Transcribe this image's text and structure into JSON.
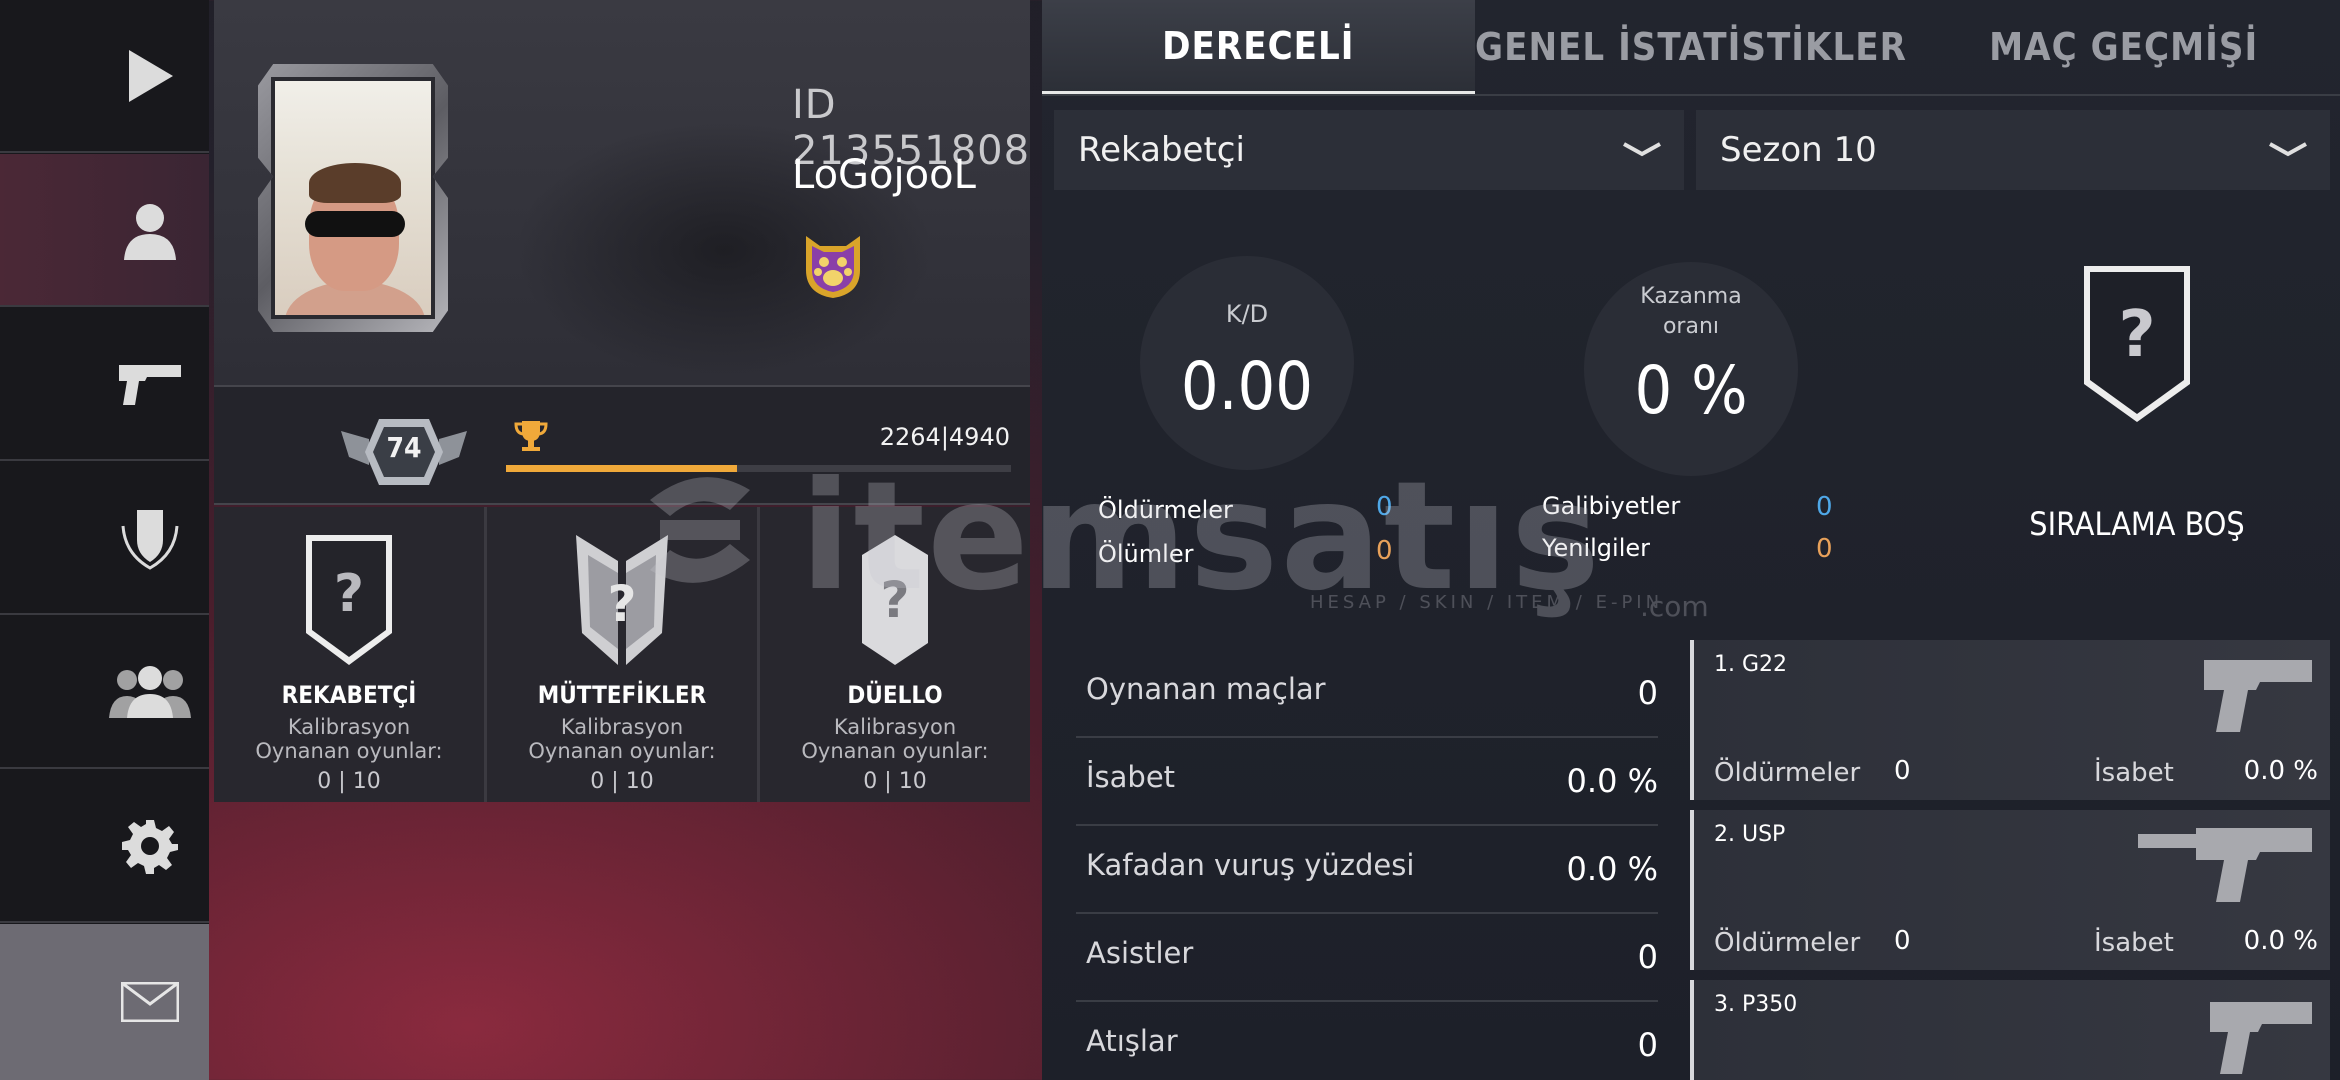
{
  "sidebar": {
    "items": [
      {
        "name": "play",
        "icon": "play-icon"
      },
      {
        "name": "profile",
        "icon": "user-icon"
      },
      {
        "name": "weapons",
        "icon": "pistol-icon"
      },
      {
        "name": "clan",
        "icon": "shield-icon"
      },
      {
        "name": "friends",
        "icon": "group-icon"
      },
      {
        "name": "settings",
        "icon": "gear-icon"
      },
      {
        "name": "mail",
        "icon": "mail-icon"
      }
    ]
  },
  "profile": {
    "id_text": "ID 213551808",
    "name": "LoGojooL",
    "level": "74",
    "xp_text": "2264|4940",
    "xp_fraction": 0.458
  },
  "modes": [
    {
      "name": "REKABETÇİ",
      "status": "Kalibrasyon",
      "played_label": "Oynanan oyunlar:",
      "played_value": "0 | 10"
    },
    {
      "name": "MÜTTEFİKLER",
      "status": "Kalibrasyon",
      "played_label": "Oynanan oyunlar:",
      "played_value": "0 | 10"
    },
    {
      "name": "DÜELLO",
      "status": "Kalibrasyon",
      "played_label": "Oynanan oyunlar:",
      "played_value": "0 | 10"
    }
  ],
  "tabs": [
    "DERECELİ",
    "GENEL İSTATİSTİKLER",
    "MAÇ GEÇMİŞİ"
  ],
  "filters": {
    "mode": "Rekabetçi",
    "season": "Sezon 10"
  },
  "summary": {
    "kd_label": "K/D",
    "kd_value": "0.00",
    "winrate_label_1": "Kazanma",
    "winrate_label_2": "oranı",
    "winrate_value": "0 %",
    "kills_label": "Öldürmeler",
    "kills_value": "0",
    "deaths_label": "Ölümler",
    "deaths_value": "0",
    "wins_label": "Galibiyetler",
    "wins_value": "0",
    "losses_label": "Yenilgiler",
    "losses_value": "0",
    "rank_text": "SIRALAMA BOŞ"
  },
  "stats": [
    {
      "label": "Oynanan maçlar",
      "value": "0"
    },
    {
      "label": "İsabet",
      "value": "0.0 %"
    },
    {
      "label": "Kafadan vuruş yüzdesi",
      "value": "0.0 %"
    },
    {
      "label": "Asistler",
      "value": "0"
    },
    {
      "label": "Atışlar",
      "value": "0"
    }
  ],
  "weapons": [
    {
      "name": "1. G22",
      "kills_label": "Öldürmeler",
      "kills": "0",
      "acc_label": "İsabet",
      "acc": "0.0 %"
    },
    {
      "name": "2. USP",
      "kills_label": "Öldürmeler",
      "kills": "0",
      "acc_label": "İsabet",
      "acc": "0.0 %"
    },
    {
      "name": "3. P350",
      "kills_label": "",
      "kills": "",
      "acc_label": "",
      "acc": ""
    }
  ],
  "watermark": {
    "main": "itemsatış",
    "sub": "HESAP / SKIN / ITEM / E-PIN",
    "com": ".com"
  },
  "colors": {
    "accent": "#f0a93a",
    "blue": "#4fa8e8",
    "orange": "#e8a15a"
  }
}
